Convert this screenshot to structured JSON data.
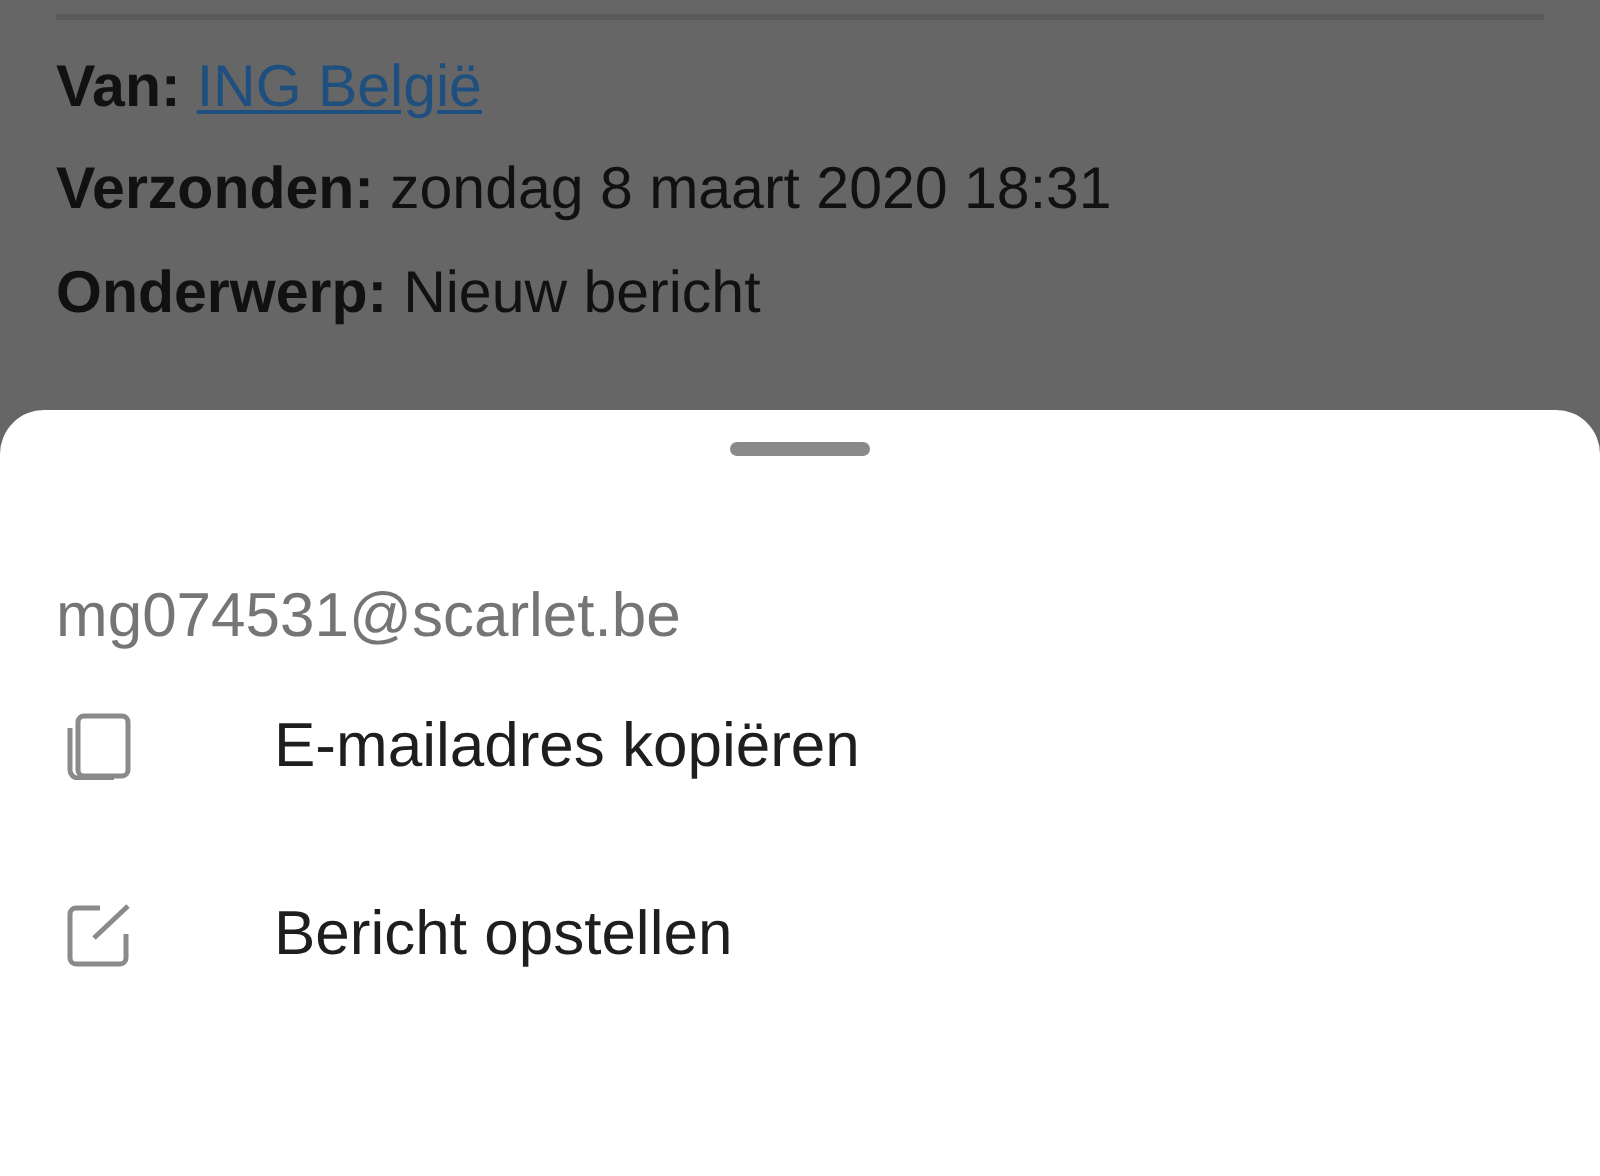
{
  "header_fields": [
    {
      "label": "Van:",
      "value": "ING België",
      "kind": "link"
    },
    {
      "label": "Verzonden:",
      "value": "zondag 8 maart 2020 18:31",
      "kind": "text"
    },
    {
      "label": "Onderwerp:",
      "value": "Nieuw bericht",
      "kind": "text"
    }
  ],
  "sheet": {
    "email": "mg074531@scarlet.be",
    "actions": [
      {
        "label": "E-mailadres kopiëren",
        "kind": "copy"
      },
      {
        "label": "Bericht opstellen",
        "kind": "compose"
      }
    ]
  }
}
